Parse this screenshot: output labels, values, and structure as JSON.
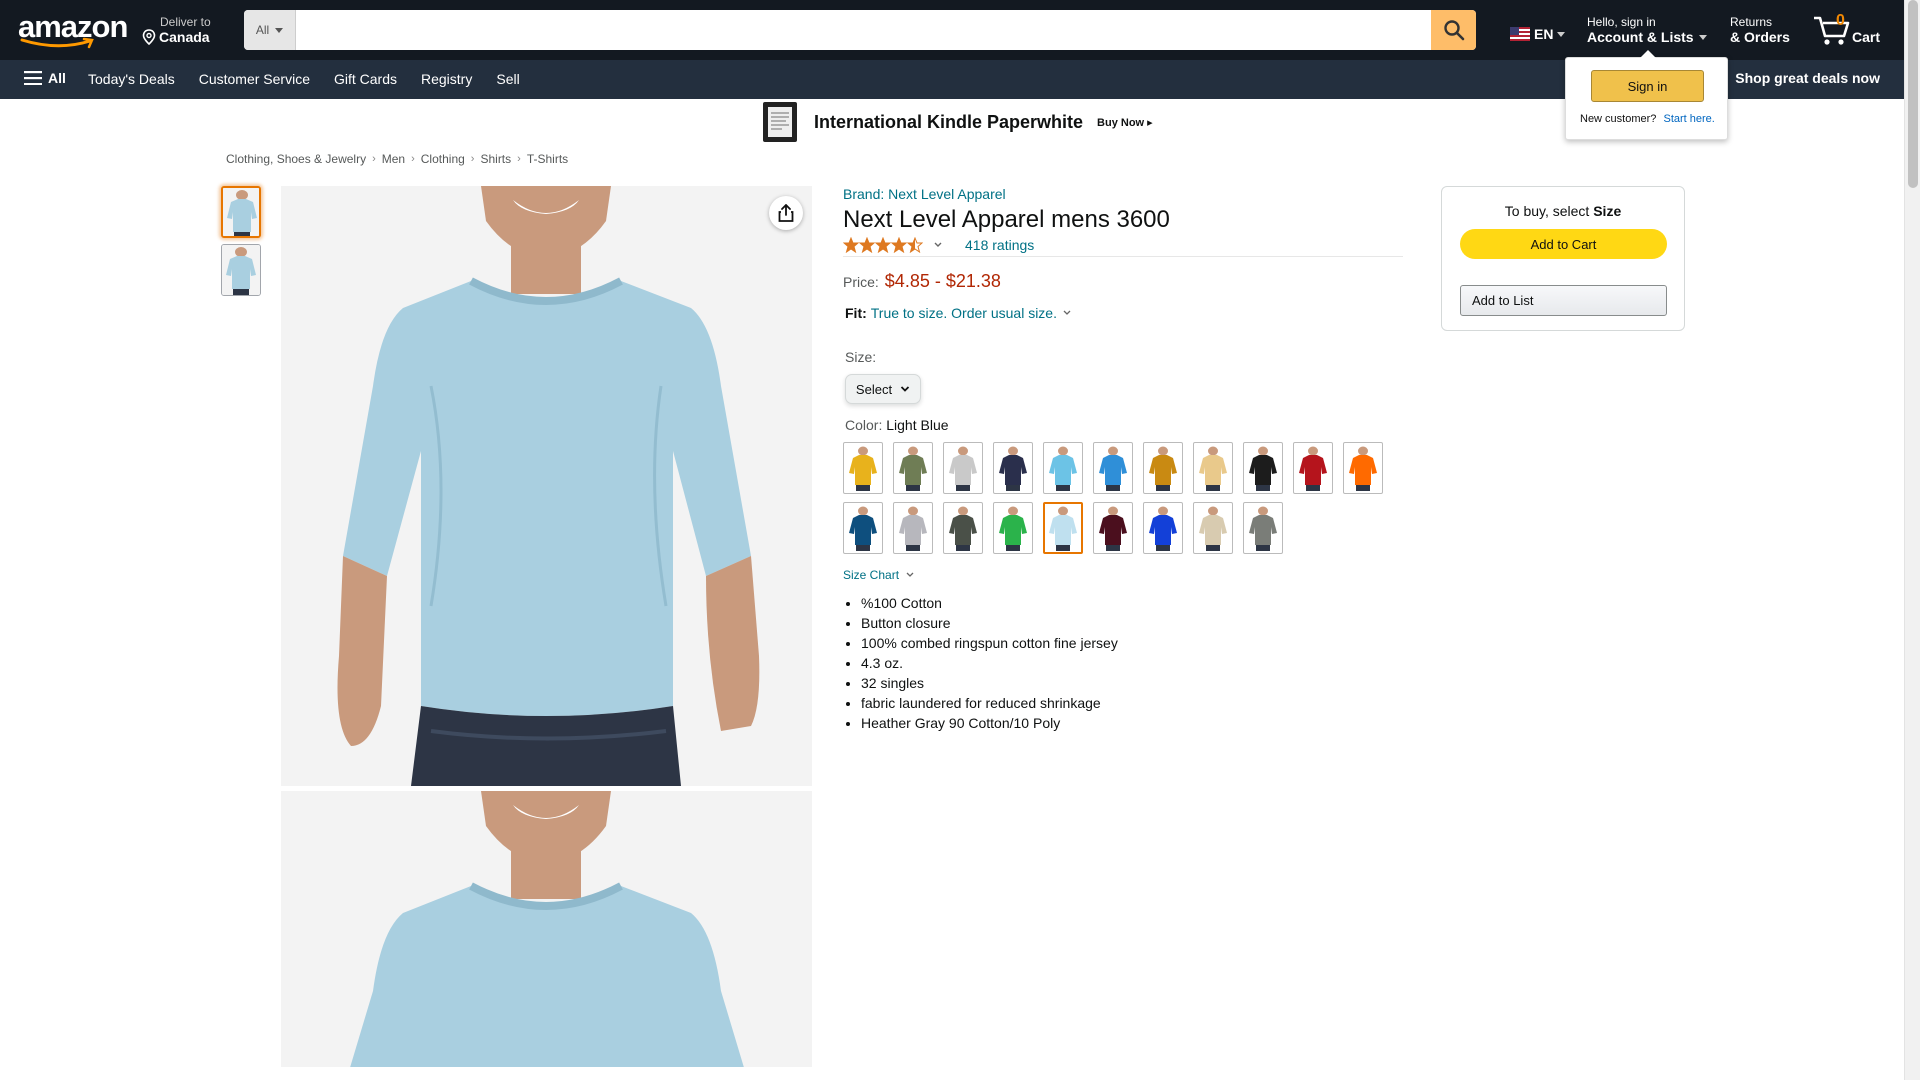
{
  "header": {
    "logo_text": "amazon",
    "deliver_small": "Deliver to",
    "deliver_location": "Canada",
    "search_category": "All",
    "search_placeholder": "",
    "language": "EN",
    "account_small": "Hello, sign in",
    "account_bold": "Account & Lists",
    "returns_small": "Returns",
    "returns_bold": "& Orders",
    "cart_count": "0",
    "cart_label": "Cart"
  },
  "nav": {
    "all_label": "All",
    "links": [
      "Today's Deals",
      "Customer Service",
      "Gift Cards",
      "Registry",
      "Sell"
    ],
    "promo": "Shop great deals now"
  },
  "signin_popover": {
    "button": "Sign in",
    "new_customer": "New customer?",
    "start_here": "Start here."
  },
  "banner": {
    "title": "International Kindle Paperwhite",
    "buy_now": "Buy Now ▸"
  },
  "breadcrumb": [
    "Clothing, Shoes & Jewelry",
    "Men",
    "Clothing",
    "Shirts",
    "T-Shirts"
  ],
  "product": {
    "brand": "Brand: Next Level Apparel",
    "title": "Next Level Apparel mens 3600",
    "rating_stars": 4.5,
    "ratings_count": "418 ratings",
    "price_label": "Price:",
    "price": "$4.85 - $21.38",
    "fit_label": "Fit:",
    "fit_value": "True to size. Order usual size.",
    "size_label": "Size:",
    "size_select": "Select",
    "color_label": "Color:",
    "color_value": "Light Blue",
    "size_chart": "Size Chart",
    "bullets": [
      "%100 Cotton",
      "Button closure",
      "100% combed ringspun cotton fine jersey",
      "4.3 oz.",
      "32 singles",
      "fabric laundered for reduced shrinkage",
      "Heather Gray 90 Cotton/10 Poly"
    ]
  },
  "swatch_colors": [
    "#e8b21c",
    "#6f7d55",
    "#c9c9c9",
    "#2a2f4c",
    "#6cc3e6",
    "#2f8fd8",
    "#c98a12",
    "#e9c98b",
    "#1c1c1c",
    "#b5141c",
    "#ff6a00",
    "#0e4f7e",
    "#b7b7bd",
    "#4a5048",
    "#2bb34b",
    "#bfe0ef",
    "#4b0f1e",
    "#1340d8",
    "#d8cbb0",
    "#7a7d78"
  ],
  "selected_swatch_index": 15,
  "buybox": {
    "heading_prefix": "To buy, select",
    "heading_bold": "Size",
    "add_to_cart": "Add to Cart",
    "add_to_list": "Add to List"
  },
  "colors": {
    "header_bg": "#131921",
    "nav_bg": "#232f3e",
    "link": "#007185",
    "price": "#b12704",
    "cart_button": "#ffd814",
    "search_button": "#febd69",
    "shirt": "#a9cfe0"
  }
}
